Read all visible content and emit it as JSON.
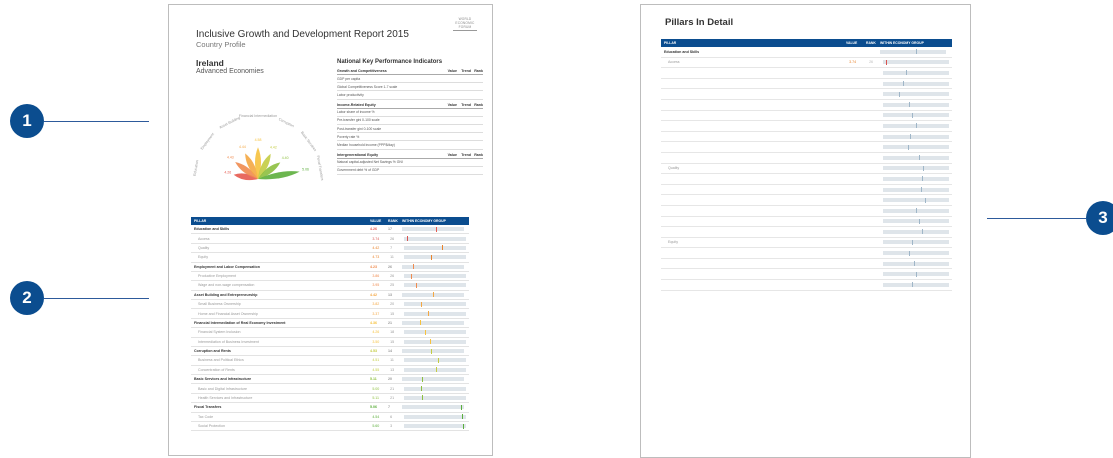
{
  "callouts": [
    "1",
    "2",
    "3"
  ],
  "page1": {
    "report_title": "Inclusive Growth and Development Report 2015",
    "subtitle": "Country Profile",
    "logo_lines": [
      "WORLD",
      "ECONOMIC",
      "FORUM"
    ],
    "country": "Ireland",
    "economy_group": "Advanced Economies",
    "chart_data": {
      "type": "radial",
      "categories": [
        "Education",
        "Employment",
        "Asset Building",
        "Financial Intermediation",
        "Corruption",
        "Basic Services",
        "Fiscal Transfers"
      ],
      "values": [
        4.26,
        4.43,
        4.44,
        4.58,
        4.42,
        4.4,
        5.06
      ],
      "colors": [
        "#e65a4f",
        "#ef8b4f",
        "#f4a742",
        "#f6c13d",
        "#c3cc42",
        "#8dbf3f",
        "#5cae3c"
      ]
    },
    "kpi": {
      "title": "National Key Performance Indicators",
      "sections": [
        {
          "name": "Growth and Competitiveness",
          "headers": [
            "Value",
            "Trend",
            "Rank"
          ],
          "rows": [
            [
              "GDP per capita",
              "",
              "",
              ""
            ],
            [
              "Global Competitiveness Score 1-7 scale",
              "",
              "",
              ""
            ],
            [
              "Labor productivity",
              "",
              "",
              ""
            ]
          ]
        },
        {
          "name": "Income-Related Equity",
          "headers": [
            "Value",
            "Trend",
            "Rank"
          ],
          "rows": [
            [
              "Labor share of income %",
              "",
              "",
              ""
            ],
            [
              "Pre-transfer gini 0-100 scale",
              "",
              "",
              ""
            ],
            [
              "Post-transfer gini 0-100 scale",
              "",
              "",
              ""
            ],
            [
              "Poverty rate %",
              "",
              "",
              ""
            ],
            [
              "Median household income (PPP$/day)",
              "",
              "",
              ""
            ]
          ]
        },
        {
          "name": "Intergenerational Equity",
          "headers": [
            "Value",
            "Trend",
            "Rank"
          ],
          "rows": [
            [
              "Natural capital-adjusted Net Savings % GNI",
              "",
              "",
              ""
            ],
            [
              "Government debt % of GDP",
              "",
              "",
              ""
            ]
          ]
        }
      ]
    },
    "pillars": {
      "headers": [
        "PILLAR",
        "VALUE",
        "RANK",
        "WITHIN ECONOMY GROUP"
      ],
      "rows": [
        {
          "kind": "pillar",
          "name": "Education and Skills",
          "value": "4.26",
          "rank": "17",
          "pos": 0.55,
          "color": "#e65a4f"
        },
        {
          "kind": "sub",
          "name": "Access",
          "value": "3.74",
          "rank": "26",
          "pos": 0.05,
          "color": "#d9534f"
        },
        {
          "kind": "sub",
          "name": "Quality",
          "value": "4.42",
          "rank": "7",
          "pos": 0.62,
          "color": "#e8822a"
        },
        {
          "kind": "sub",
          "name": "Equity",
          "value": "4.73",
          "rank": "11",
          "pos": 0.45,
          "color": "#e8822a"
        },
        {
          "kind": "pillar",
          "name": "Employment and Labor Compensation",
          "value": "4.23",
          "rank": "26",
          "pos": 0.18,
          "color": "#ef8b4f"
        },
        {
          "kind": "sub",
          "name": "Productive Employment",
          "value": "3.86",
          "rank": "26",
          "pos": 0.12,
          "color": "#ef8b4f"
        },
        {
          "kind": "sub",
          "name": "Wage and non-wage compensation",
          "value": "3.95",
          "rank": "25",
          "pos": 0.2,
          "color": "#ef8b4f"
        },
        {
          "kind": "pillar",
          "name": "Asset Building and Entrepreneurship",
          "value": "4.42",
          "rank": "13",
          "pos": 0.5,
          "color": "#f4a742"
        },
        {
          "kind": "sub",
          "name": "Small Business Ownership",
          "value": "3.82",
          "rank": "20",
          "pos": 0.28,
          "color": "#f4a742"
        },
        {
          "kind": "sub",
          "name": "Home and Financial Asset Ownership",
          "value": "3.37",
          "rank": "15",
          "pos": 0.4,
          "color": "#f4a742"
        },
        {
          "kind": "pillar",
          "name": "Financial Intermediation of Real Economy Investment",
          "value": "4.36",
          "rank": "21",
          "pos": 0.3,
          "color": "#f6c13d"
        },
        {
          "kind": "sub",
          "name": "Financial System Inclusion",
          "value": "4.26",
          "rank": "18",
          "pos": 0.35,
          "color": "#f6c13d"
        },
        {
          "kind": "sub",
          "name": "Intermediation of Business Investment",
          "value": "3.50",
          "rank": "15",
          "pos": 0.42,
          "color": "#f6c13d"
        },
        {
          "kind": "pillar",
          "name": "Corruption and Rents",
          "value": "4.53",
          "rank": "14",
          "pos": 0.48,
          "color": "#c3cc42"
        },
        {
          "kind": "sub",
          "name": "Business and Political Ethics",
          "value": "4.51",
          "rank": "11",
          "pos": 0.55,
          "color": "#c3cc42"
        },
        {
          "kind": "sub",
          "name": "Concentration of Rents",
          "value": "4.55",
          "rank": "13",
          "pos": 0.52,
          "color": "#c3cc42"
        },
        {
          "kind": "pillar",
          "name": "Basic Services and Infrastructure",
          "value": "5.11",
          "rank": "20",
          "pos": 0.32,
          "color": "#8dbf3f"
        },
        {
          "kind": "sub",
          "name": "Basic and Digital Infrastructure",
          "value": "5.00",
          "rank": "21",
          "pos": 0.28,
          "color": "#8dbf3f"
        },
        {
          "kind": "sub",
          "name": "Health Services and Infrastructure",
          "value": "5.11",
          "rank": "21",
          "pos": 0.3,
          "color": "#8dbf3f"
        },
        {
          "kind": "pillar",
          "name": "Fiscal Transfers",
          "value": "5.06",
          "rank": "7",
          "pos": 0.97,
          "color": "#5cae3c"
        },
        {
          "kind": "sub",
          "name": "Tax Code",
          "value": "4.54",
          "rank": "6",
          "pos": 0.95,
          "color": "#5cae3c"
        },
        {
          "kind": "sub",
          "name": "Social Protection",
          "value": "5.60",
          "rank": "3",
          "pos": 0.97,
          "color": "#5cae3c"
        }
      ]
    }
  },
  "page2": {
    "title": "Pillars In Detail",
    "headers": [
      "PILLAR",
      "VALUE",
      "RANK",
      "WITHIN ECONOMY GROUP"
    ],
    "rows": [
      {
        "kind": "pillar",
        "name": "Education and Skills",
        "value": "",
        "rank": "",
        "pos": 0.55
      },
      {
        "kind": "sub",
        "name": "Access",
        "value": "3.74",
        "rank": "26",
        "pos": 0.05,
        "hl": true
      },
      {
        "kind": "ind",
        "name": "",
        "value": "",
        "rank": "",
        "pos": 0.35
      },
      {
        "kind": "ind",
        "name": "",
        "value": "",
        "rank": "",
        "pos": 0.3
      },
      {
        "kind": "ind",
        "name": "",
        "value": "",
        "rank": "",
        "pos": 0.25
      },
      {
        "kind": "ind",
        "name": "",
        "value": "",
        "rank": "",
        "pos": 0.4
      },
      {
        "kind": "ind",
        "name": "",
        "value": "",
        "rank": "",
        "pos": 0.45
      },
      {
        "kind": "ind",
        "name": "",
        "value": "",
        "rank": "",
        "pos": 0.5
      },
      {
        "kind": "ind",
        "name": "",
        "value": "",
        "rank": "",
        "pos": 0.42
      },
      {
        "kind": "ind",
        "name": "",
        "value": "",
        "rank": "",
        "pos": 0.38
      },
      {
        "kind": "ind",
        "name": "",
        "value": "",
        "rank": "",
        "pos": 0.55
      },
      {
        "kind": "sub",
        "name": "Quality",
        "value": "",
        "rank": "",
        "pos": 0.62
      },
      {
        "kind": "ind",
        "name": "",
        "value": "",
        "rank": "",
        "pos": 0.6
      },
      {
        "kind": "ind",
        "name": "",
        "value": "",
        "rank": "",
        "pos": 0.58
      },
      {
        "kind": "ind",
        "name": "",
        "value": "",
        "rank": "",
        "pos": 0.65
      },
      {
        "kind": "ind",
        "name": "",
        "value": "",
        "rank": "",
        "pos": 0.5
      },
      {
        "kind": "ind",
        "name": "",
        "value": "",
        "rank": "",
        "pos": 0.55
      },
      {
        "kind": "ind",
        "name": "",
        "value": "",
        "rank": "",
        "pos": 0.6
      },
      {
        "kind": "sub",
        "name": "Equity",
        "value": "",
        "rank": "",
        "pos": 0.45
      },
      {
        "kind": "ind",
        "name": "",
        "value": "",
        "rank": "",
        "pos": 0.4
      },
      {
        "kind": "ind",
        "name": "",
        "value": "",
        "rank": "",
        "pos": 0.48
      },
      {
        "kind": "ind",
        "name": "",
        "value": "",
        "rank": "",
        "pos": 0.5
      },
      {
        "kind": "ind",
        "name": "",
        "value": "",
        "rank": "",
        "pos": 0.45
      }
    ]
  }
}
